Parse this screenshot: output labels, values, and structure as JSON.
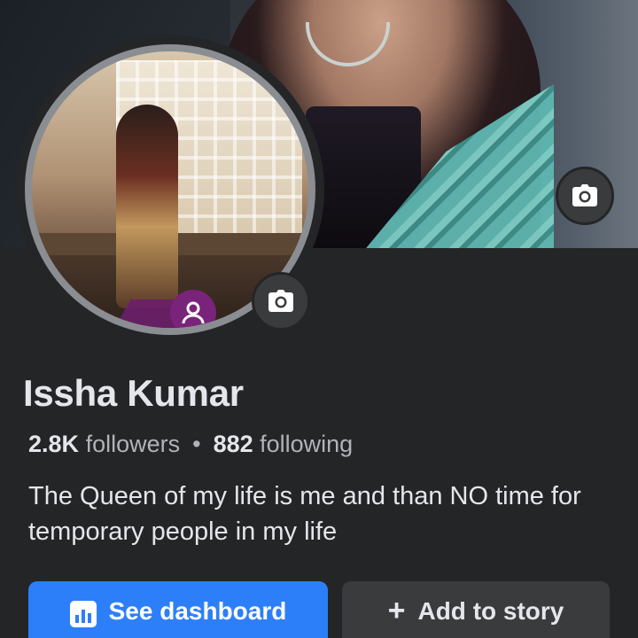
{
  "profile": {
    "name": "Issha Kumar",
    "followers_count": "2.8K",
    "followers_label": "followers",
    "separator": "•",
    "following_count": "882",
    "following_label": "following",
    "bio": "The Queen of my life is me and than NO time for temporary people in my life"
  },
  "actions": {
    "dashboard_label": "See dashboard",
    "add_story_icon": "+",
    "add_story_label": "Add to story"
  },
  "icons": {
    "cover_camera": "camera-icon",
    "avatar_camera": "camera-icon",
    "avatar_badge": "profile-guard-icon",
    "dashboard": "bar-chart-icon",
    "add_story": "plus-icon"
  },
  "colors": {
    "background": "#242526",
    "primary_button": "#2d7ff9",
    "secondary_button": "#3a3b3c",
    "text_primary": "#e4e6eb",
    "text_secondary": "#b0b3b8"
  }
}
